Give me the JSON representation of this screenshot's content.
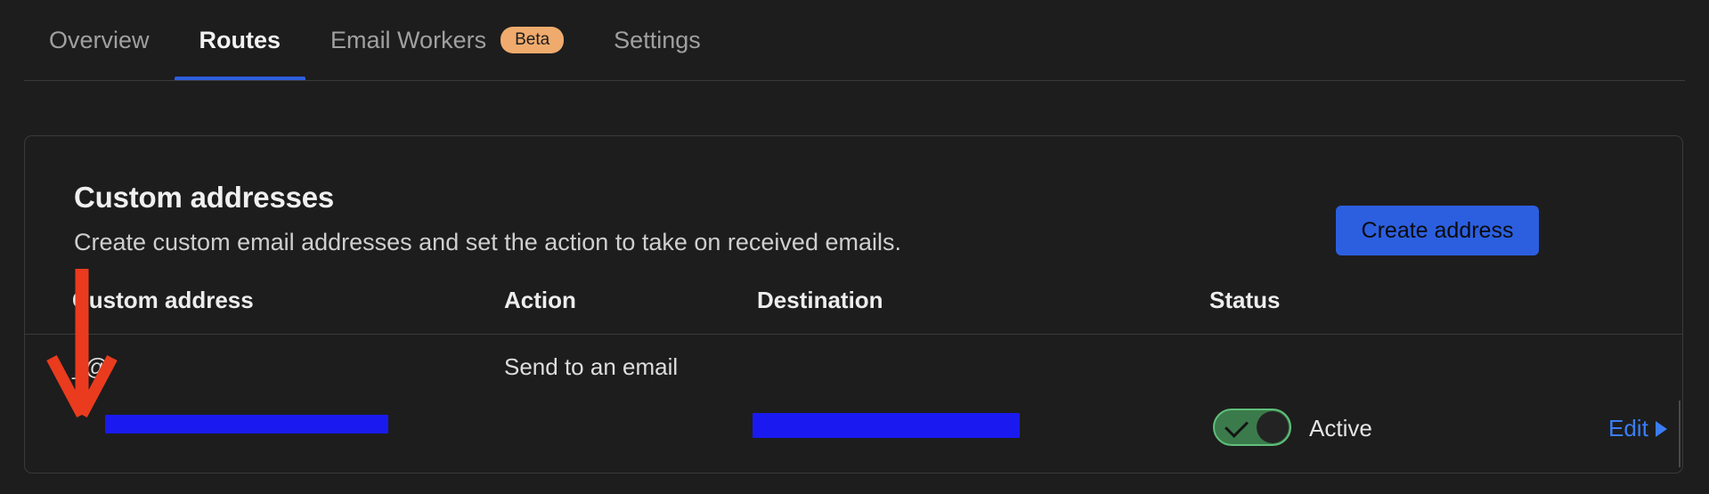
{
  "tabs": [
    {
      "label": "Overview",
      "active": false,
      "badge": null
    },
    {
      "label": "Routes",
      "active": true,
      "badge": null
    },
    {
      "label": "Email Workers",
      "active": false,
      "badge": "Beta"
    },
    {
      "label": "Settings",
      "active": false,
      "badge": null
    }
  ],
  "card": {
    "title": "Custom addresses",
    "description": "Create custom email addresses and set the action to take on received emails.",
    "create_button": "Create address"
  },
  "table": {
    "headers": {
      "address": "Custom address",
      "action": "Action",
      "destination": "Destination",
      "status": "Status"
    },
    "rows": [
      {
        "address_prefix": "_@",
        "address_redacted": true,
        "action": "Send to an email",
        "destination_redacted": true,
        "status": "Active",
        "status_enabled": true,
        "edit_label": "Edit"
      }
    ]
  },
  "icons": {
    "toggle_check": "check-icon",
    "edit_caret": "caret-right-icon",
    "annotation": "red-down-arrow"
  },
  "colors": {
    "background": "#1d1d1d",
    "accent_blue": "#2c5fe0",
    "link_blue": "#3b7df5",
    "beta_badge": "#efab6d",
    "toggle_green": "#3b7a4b",
    "toggle_border": "#5fbf7a",
    "redaction_blue": "#1a1af0",
    "annotation_red": "#ea3b1e",
    "border": "#3a3a3a"
  }
}
